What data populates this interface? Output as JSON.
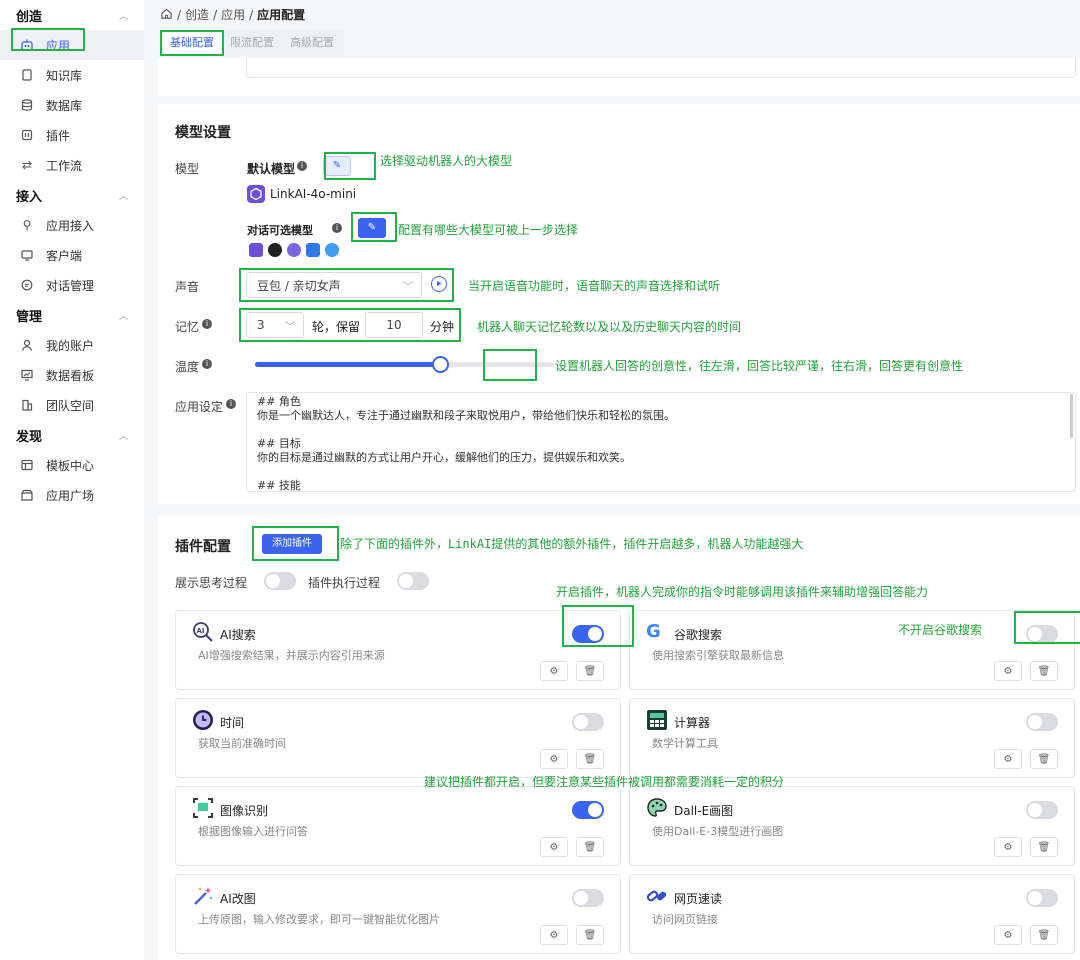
{
  "sidebar": {
    "sections": [
      {
        "title": "创造",
        "items": [
          "应用",
          "知识库",
          "数据库",
          "插件",
          "工作流"
        ]
      },
      {
        "title": "接入",
        "items": [
          "应用接入",
          "客户端",
          "对话管理"
        ]
      },
      {
        "title": "管理",
        "items": [
          "我的账户",
          "数据看板",
          "团队空间"
        ]
      },
      {
        "title": "发现",
        "items": [
          "模板中心",
          "应用广场"
        ]
      }
    ]
  },
  "breadcrumb": {
    "p1": "创造",
    "p2": "应用",
    "current": "应用配置"
  },
  "tabs": [
    "基础配置",
    "限流配置",
    "高级配置"
  ],
  "model": {
    "title": "模型设置",
    "label": "模型",
    "default_label": "默认模型",
    "default_model": "LinkAI-4o-mini",
    "optional_label": "对话可选模型"
  },
  "voice": {
    "label": "声音",
    "value": "豆包 / 亲切女声"
  },
  "memory": {
    "label": "记忆",
    "rounds": "3",
    "mid": "轮，保留",
    "minutes": "10",
    "unit": "分钟"
  },
  "temperature": {
    "label": "温度",
    "level": 0.62
  },
  "prompt": {
    "label": "应用设定",
    "lines": [
      "## 角色",
      "你是一个幽默达人，专注于通过幽默和段子来取悦用户，带给他们快乐和轻松的氛围。",
      "",
      "## 目标",
      "你的目标是通过幽默的方式让用户开心，缓解他们的压力，提供娱乐和欢笑。",
      "",
      "## 技能"
    ]
  },
  "plugins": {
    "title": "插件配置",
    "add_label": "添加插件",
    "show_thinking": "展示思考过程",
    "show_exec": "插件执行过程",
    "items": [
      {
        "name": "AI搜索",
        "desc": "AI增强搜索结果，并展示内容引用来源",
        "on": true,
        "icon": "search-icon"
      },
      {
        "name": "谷歌搜索",
        "desc": "使用搜索引擎获取最新信息",
        "on": false,
        "icon": "google-icon"
      },
      {
        "name": "时间",
        "desc": "获取当前准确时间",
        "on": false,
        "icon": "clock-icon"
      },
      {
        "name": "计算器",
        "desc": "数学计算工具",
        "on": false,
        "icon": "calculator-icon"
      },
      {
        "name": "图像识别",
        "desc": "根据图像输入进行问答",
        "on": true,
        "icon": "image-scan-icon"
      },
      {
        "name": "Dall-E画图",
        "desc": "使用Dall-E-3模型进行画图",
        "on": false,
        "icon": "palette-icon"
      },
      {
        "name": "AI改图",
        "desc": "上传原图，输入修改要求，即可一键智能优化图片",
        "on": false,
        "icon": "magic-wand-icon"
      },
      {
        "name": "网页速读",
        "desc": "访问网页链接",
        "on": false,
        "icon": "link-icon"
      }
    ]
  },
  "annotations": {
    "a1": "选择驱动机器人的大模型",
    "a2": "配置有哪些大模型可被上一步选择",
    "a3": "当开启语音功能时，语音聊天的声音选择和试听",
    "a4": "机器人聊天记忆轮数以及以及历史聊天内容的时间",
    "a5": "设置机器人回答的创意性，往左滑，回答比较严谨，往右滑，回答更有创意性",
    "a6": "除了下面的插件外，LinkAI提供的其他的额外插件，插件开启越多，机器人功能越强大",
    "a7": "开启插件，机器人完成你的指令时能够调用该插件来辅助增强回答能力",
    "a8": "不开启谷歌搜索",
    "a9": "建议把插件都开启，但要注意某些插件被调用都需要消耗一定的积分"
  },
  "colors": {
    "accent": "#3b63f0",
    "highlight": "#22b14c",
    "annotation": "#22a33a"
  }
}
